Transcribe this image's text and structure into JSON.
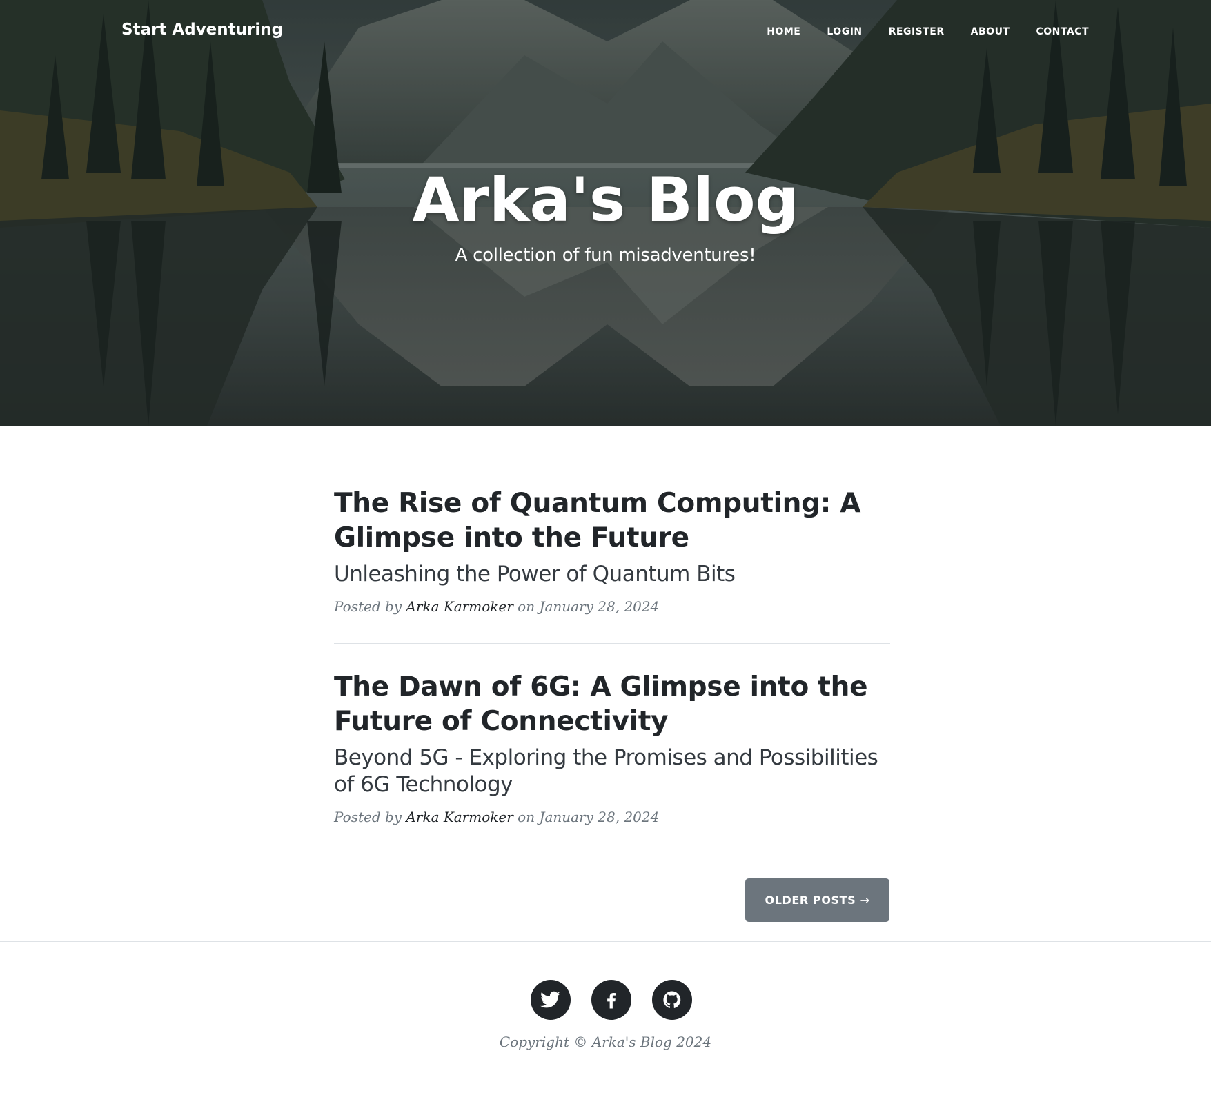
{
  "navbar": {
    "brand": "Start Adventuring",
    "links": [
      {
        "label": "HOME"
      },
      {
        "label": "LOGIN"
      },
      {
        "label": "REGISTER"
      },
      {
        "label": "ABOUT"
      },
      {
        "label": "CONTACT"
      }
    ]
  },
  "header": {
    "title": "Arka's Blog",
    "subtitle": "A collection of fun misadventures!"
  },
  "posts": [
    {
      "title": "The Rise of Quantum Computing: A Glimpse into the Future",
      "subtitle": "Unleashing the Power of Quantum Bits",
      "meta_prefix": "Posted by",
      "author": "Arka Karmoker",
      "meta_date": "on January 28, 2024"
    },
    {
      "title": "The Dawn of 6G: A Glimpse into the Future of Connectivity",
      "subtitle": "Beyond 5G - Exploring the Promises and Possibilities of 6G Technology",
      "meta_prefix": "Posted by",
      "author": "Arka Karmoker",
      "meta_date": "on January 28, 2024"
    }
  ],
  "pager": {
    "older_label": "OLDER POSTS →"
  },
  "footer": {
    "social": [
      {
        "icon": "twitter-icon"
      },
      {
        "icon": "facebook-icon"
      },
      {
        "icon": "github-icon"
      }
    ],
    "copyright": "Copyright © Arka's Blog 2024"
  },
  "colors": {
    "text_dark": "#212529",
    "muted": "#6c757d",
    "button_gray": "#6c757d",
    "divider": "#dee2e6"
  }
}
